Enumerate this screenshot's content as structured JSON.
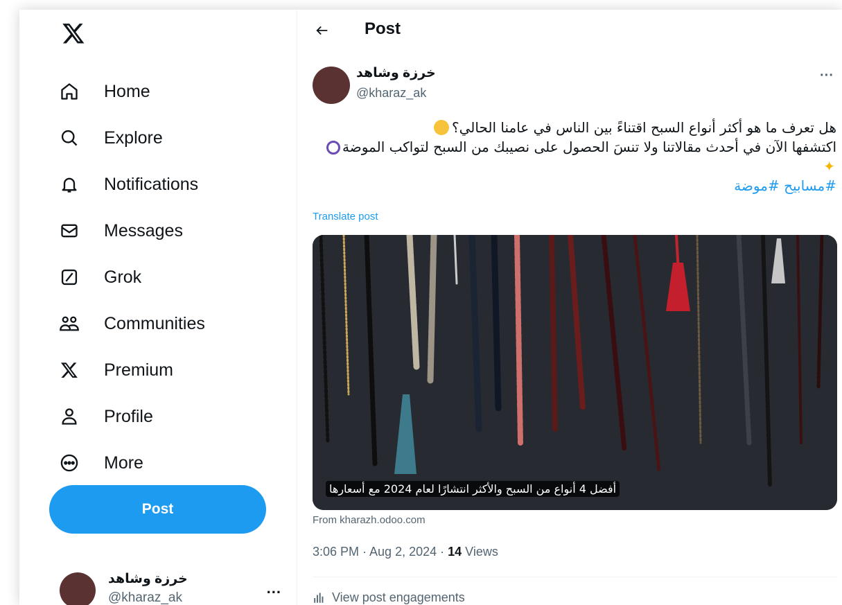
{
  "nav": {
    "items": [
      {
        "label": "Home",
        "icon": "home-icon"
      },
      {
        "label": "Explore",
        "icon": "search-icon"
      },
      {
        "label": "Notifications",
        "icon": "bell-icon"
      },
      {
        "label": "Messages",
        "icon": "envelope-icon"
      },
      {
        "label": "Grok",
        "icon": "grok-icon"
      },
      {
        "label": "Communities",
        "icon": "communities-icon"
      },
      {
        "label": "Premium",
        "icon": "x-logo-icon"
      },
      {
        "label": "Profile",
        "icon": "person-icon"
      },
      {
        "label": "More",
        "icon": "more-circle-icon"
      }
    ],
    "post_button": "Post"
  },
  "account": {
    "name": "خرزة وشاهد",
    "handle": "@kharaz_ak",
    "more": "..."
  },
  "header": {
    "title": "Post"
  },
  "post": {
    "author_name": "خرزة وشاهد",
    "author_handle": "@kharaz_ak",
    "more": "···",
    "line1": "هل تعرف ما هو أكثر أنواع السبح اقتناءً بين الناس في عامنا الحالي؟",
    "line2": "اكتشفها الآن في أحدث مقالاتنا ولا تنسَ الحصول على نصيبك من السبح لتواكب الموضة",
    "hashtags": "#مسابيح #موضة",
    "translate": "Translate post",
    "card_caption": "أفضل 4 أنواع من السبح والأكثر انتشارًا لعام 2024 مع أسعارها",
    "card_source": "From kharazh.odoo.com",
    "time": "3:06 PM · Aug 2, 2024 · ",
    "views_count": "14",
    "views_label": " Views",
    "engagements": "View post engagements"
  },
  "colors": {
    "accent": "#1d9bf0",
    "text": "#0f1419",
    "muted": "#536471",
    "avatar": "#5a3232"
  }
}
